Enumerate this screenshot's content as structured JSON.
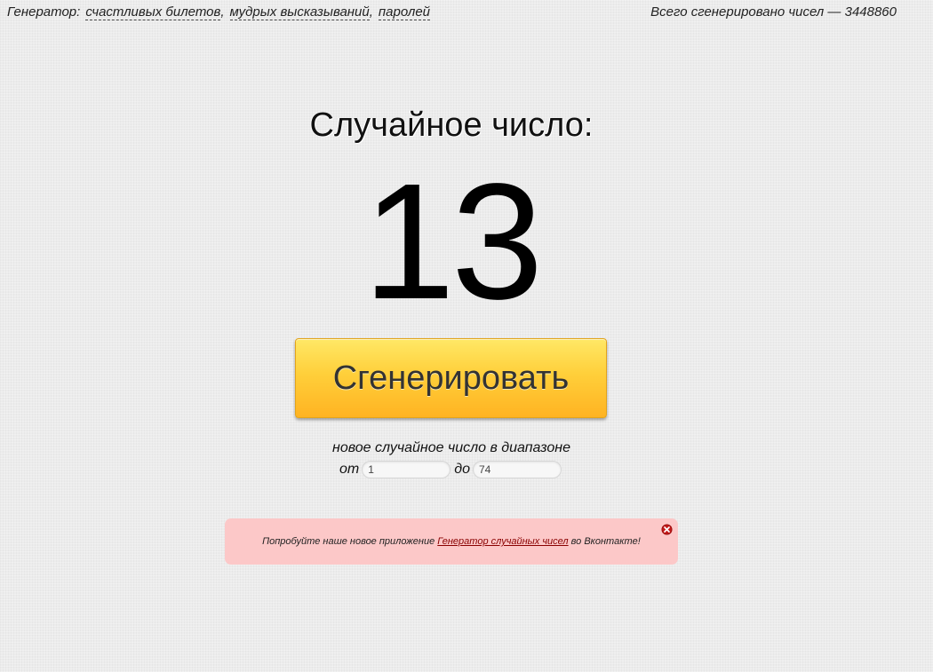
{
  "topbar": {
    "label": "Генератор:",
    "links": [
      "счастливых билетов",
      "мудрых высказываний",
      "паролей"
    ],
    "comma": ",",
    "counter": "Всего сгенерировано чисел — 3448860"
  },
  "main": {
    "title": "Случайное число:",
    "number": "13",
    "button_label": "Сгенерировать",
    "range_caption": "новое случайное число в диапазоне",
    "from_label": "от",
    "from_value": "1",
    "to_label": "до",
    "to_value": "74"
  },
  "notice": {
    "text_before": "Попробуйте наше новое приложение ",
    "link": "Генератор случайных чисел",
    "text_after": " во Вконтакте!",
    "close_icon": "close-circle-icon",
    "background_color": "#fcc8c8",
    "close_color": "#9b0d0d"
  },
  "colors": {
    "button_top": "#ffe866",
    "button_bottom": "#ffb322",
    "background": "#ececec"
  }
}
